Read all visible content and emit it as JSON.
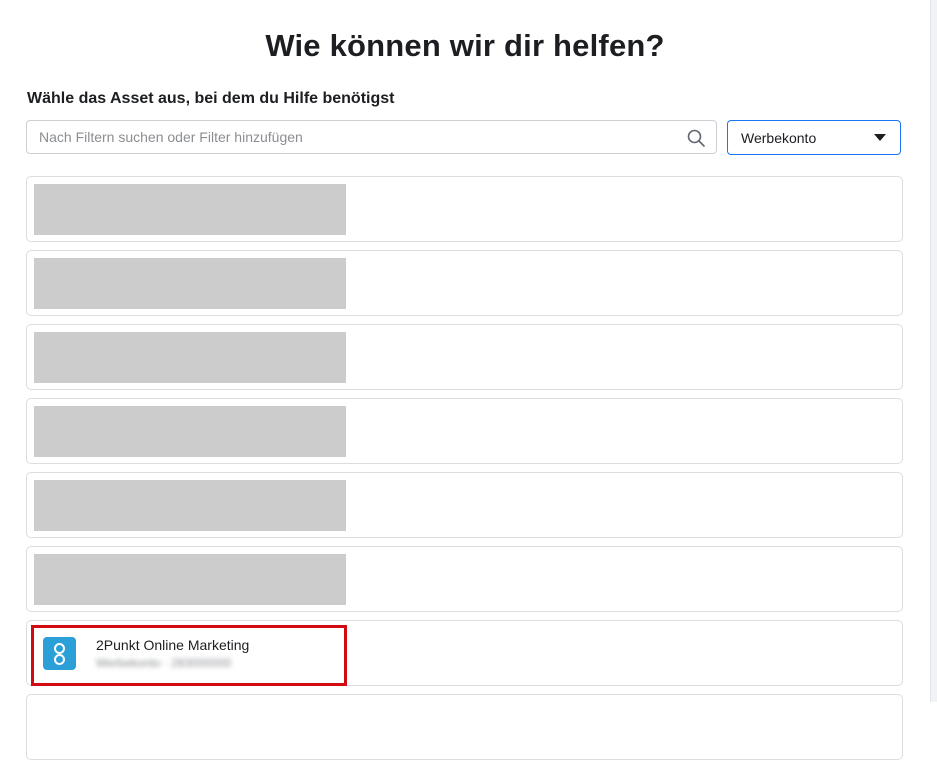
{
  "page": {
    "title": "Wie können wir dir helfen?",
    "section_label": "Wähle das Asset aus, bei dem du Hilfe benötigst"
  },
  "search": {
    "placeholder": "Nach Filtern suchen oder Filter hinzufügen",
    "value": "",
    "icon": "search-icon"
  },
  "filter_select": {
    "selected": "Werbekonto",
    "icon": "caret-down-icon",
    "accent_color": "#1877f2"
  },
  "assets": {
    "redacted_count": 6,
    "redacted_color": "#cccccc",
    "highlighted": {
      "name": "2Punkt Online Marketing",
      "subtitle": "Werbekonto · 283000000",
      "subtitle_blurred": true,
      "avatar_color": "#2b9fd8",
      "avatar_icon": "asset-avatar-icon"
    }
  },
  "annotation": {
    "highlight_color": "#d20a11"
  }
}
